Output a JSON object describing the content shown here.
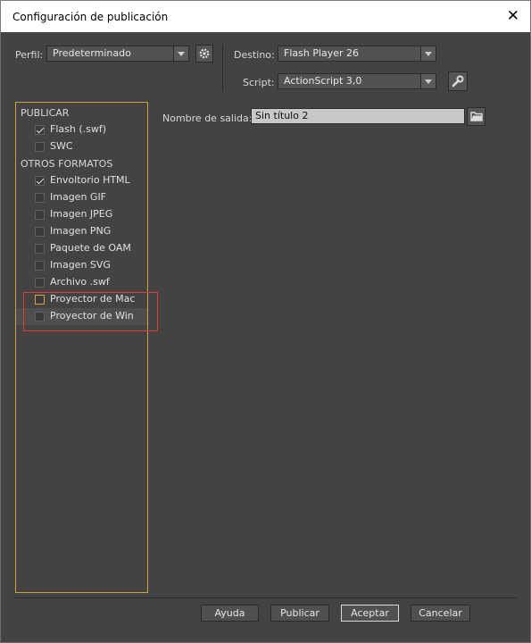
{
  "window": {
    "title": "Configuración de publicación",
    "close_symbol": "✕"
  },
  "header": {
    "perfil_label": "Perfil:",
    "perfil_value": "Predeterminado",
    "destino_label": "Destino:",
    "destino_value": "Flash Player 26",
    "script_label": "Script:",
    "script_value": "ActionScript 3,0"
  },
  "left_panel": {
    "publicar_heading": "PUBLICAR",
    "publicar_items": [
      {
        "label": "Flash (.swf)",
        "checked": true
      },
      {
        "label": "SWC",
        "checked": false
      }
    ],
    "otros_heading": "OTROS FORMATOS",
    "otros_items": [
      {
        "label": "Envoltorio HTML",
        "checked": true
      },
      {
        "label": "Imagen GIF",
        "checked": false
      },
      {
        "label": "Imagen JPEG",
        "checked": false
      },
      {
        "label": "Imagen PNG",
        "checked": false
      },
      {
        "label": "Paquete de OAM",
        "checked": false
      },
      {
        "label": "Imagen SVG",
        "checked": false
      },
      {
        "label": "Archivo .swf",
        "checked": false
      },
      {
        "label": "Proyector de Mac",
        "checked": false
      },
      {
        "label": "Proyector de Win",
        "checked": false
      }
    ]
  },
  "output": {
    "label": "Nombre de salida:",
    "value": "Sin título 2"
  },
  "buttons": {
    "help": "Ayuda",
    "publish": "Publicar",
    "ok": "Aceptar",
    "cancel": "Cancelar"
  },
  "icons": {
    "settings": "gear-icon",
    "wrench": "wrench-icon",
    "folder": "folder-icon"
  },
  "colors": {
    "panel_border": "#c9a53a",
    "highlight_box": "#e03a3a"
  }
}
